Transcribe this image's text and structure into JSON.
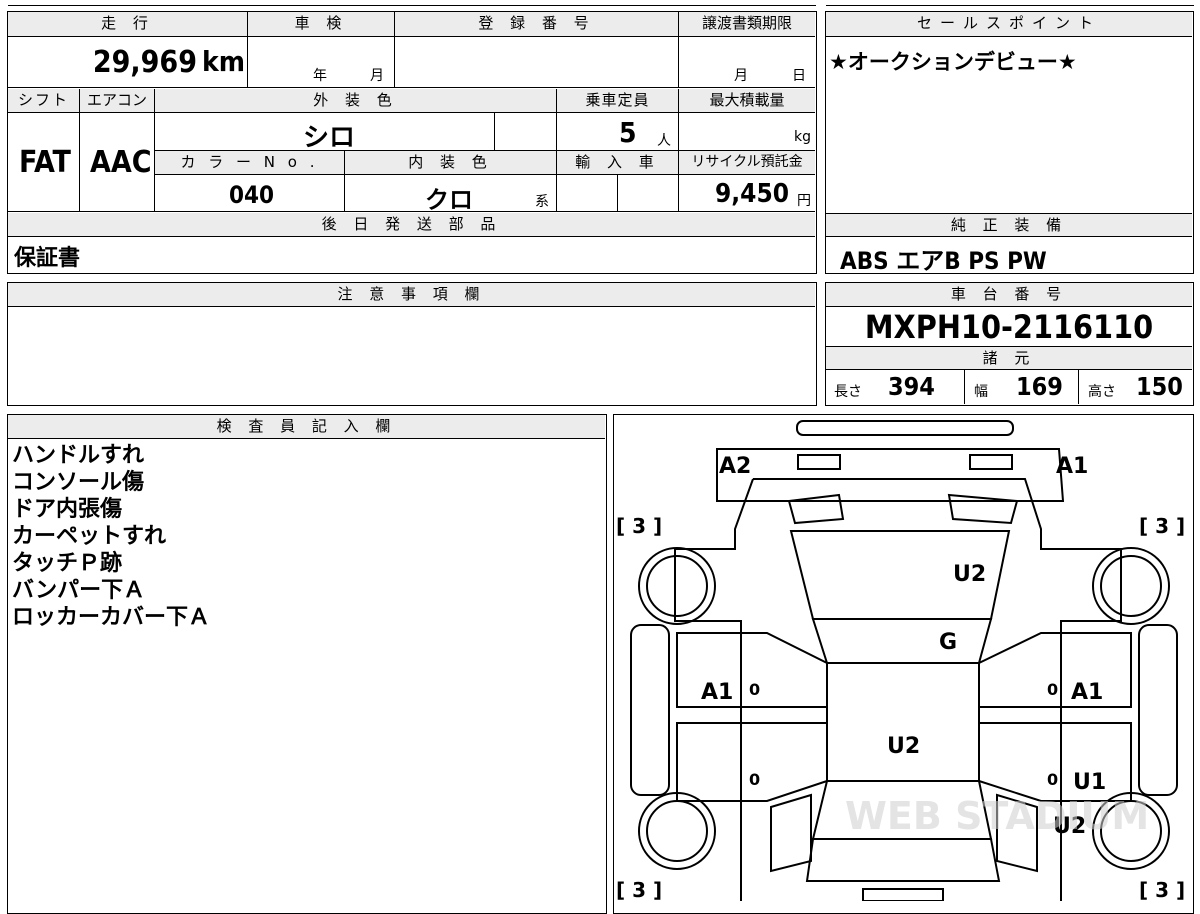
{
  "labels": {
    "mileage": "走 行",
    "shaken": "車 検",
    "registration": "登 録 番 号",
    "transfer_deadline": "譲渡書類期限",
    "sales_point": "セールスポイント",
    "shift": "シフト",
    "aircon": "エアコン",
    "exterior_color": "外 装 色",
    "capacity": "乗車定員",
    "max_load": "最大積載量",
    "color_no": "カ ラ ー N o .",
    "interior_color": "内 装 色",
    "import": "輸 入 車",
    "recycle_fee": "リサイクル預託金",
    "later_parts": "後 日 発 送 部 品",
    "genuine_equipment": "純 正 装 備",
    "notes": "注 意 事 項 欄",
    "chassis_no": "車 台 番 号",
    "specs": "諸 元",
    "inspector": "検 査 員 記 入 欄"
  },
  "values": {
    "mileage": "29,969",
    "mileage_unit": "km",
    "shaken_year": "年",
    "shaken_month": "月",
    "deadline_month": "月",
    "deadline_day": "日",
    "sales_point": "★オークションデビュー★",
    "shift": "FAT",
    "aircon": "AAC",
    "exterior_color": "シロ",
    "capacity": "5",
    "capacity_unit": "人",
    "max_load_unit": "kg",
    "color_no": "040",
    "interior_color": "クロ",
    "interior_suffix": "系",
    "recycle_fee": "9,450",
    "recycle_unit": "円",
    "later_parts": "保証書",
    "genuine_equipment": "ABS エアB PS PW",
    "chassis_no": "MXPH10-2116110",
    "length_label": "長さ",
    "length": "394",
    "width_label": "幅",
    "width": "169",
    "height_label": "高さ",
    "height": "150"
  },
  "inspector_notes": [
    "ハンドルすれ",
    "コンソール傷",
    "ドア内張傷",
    "カーペットすれ",
    "タッチＰ跡",
    "バンパー下Ａ",
    "ロッカーカバー下Ａ"
  ],
  "diagram_marks": {
    "rear_left": "A2",
    "rear_right": "A1",
    "tire_tl": "[ 3 ]",
    "tire_tr": "[ 3 ]",
    "tire_bl": "[ 3 ]",
    "tire_br": "[ 3 ]",
    "roof": "U2",
    "rear_glass": "G",
    "door_left_rear": "A1",
    "door_right_rear": "A1",
    "roof_center": "U2",
    "door_right_front": "U1",
    "fender_right": "U2",
    "zero": "0"
  },
  "watermark": "WEB STADIUM"
}
